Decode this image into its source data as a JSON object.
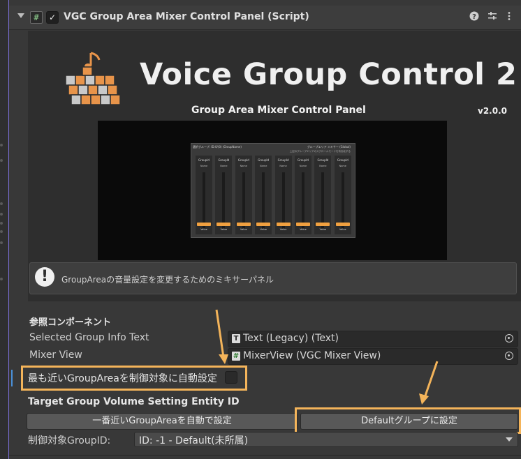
{
  "header": {
    "title": "VGC Group Area Mixer Control Panel (Script)",
    "script_icon": "#",
    "enabled_check": "✓",
    "icons": [
      "help-icon",
      "presets-icon",
      "more-options-icon"
    ]
  },
  "banner": {
    "brand": "Voice Group Control 2",
    "subtitle": "Group Area Mixer Control Panel",
    "version": "v2.0.0",
    "preview": {
      "header": "選択グループ: ID:0/(0) (GroupName)",
      "header_right": "グループエリア ミキサー (Global)",
      "sub_note": "上記のグループエリアのスクロールモードを有効化する",
      "channel_label": "GroupId",
      "channel_name": "Name",
      "channel_value": "Value",
      "channel_count": 8
    }
  },
  "help": {
    "icon": "!",
    "text": "GroupAreaの音量設定を変更するためのミキサーパネル"
  },
  "references": {
    "section_title": "参照コンポーネント",
    "selected_info": {
      "label": "Selected Group Info Text",
      "value": "Text (Legacy) (Text)",
      "icon": "T"
    },
    "mixer_view": {
      "label": "Mixer View",
      "value": "MixerView (VGC Mixer View)",
      "icon": "#"
    }
  },
  "auto_target": {
    "label": "最も近いGroupAreaを制御対象に自動設定",
    "checked": false
  },
  "target": {
    "section_title": "Target Group Volume Setting Entity ID",
    "btn_nearest": "一番近いGroupAreaを自動で設定",
    "btn_default": "Defaultグループに設定",
    "groupid_label": "制御対象GroupID:",
    "groupid_value": "ID: -1 - Default(未所属)"
  },
  "colors": {
    "background": "#383838",
    "banner": "#2e2e2e",
    "highlight": "#f4b45a",
    "logo_cube": "#e8944a",
    "selected_marker": "#4a90d9"
  }
}
